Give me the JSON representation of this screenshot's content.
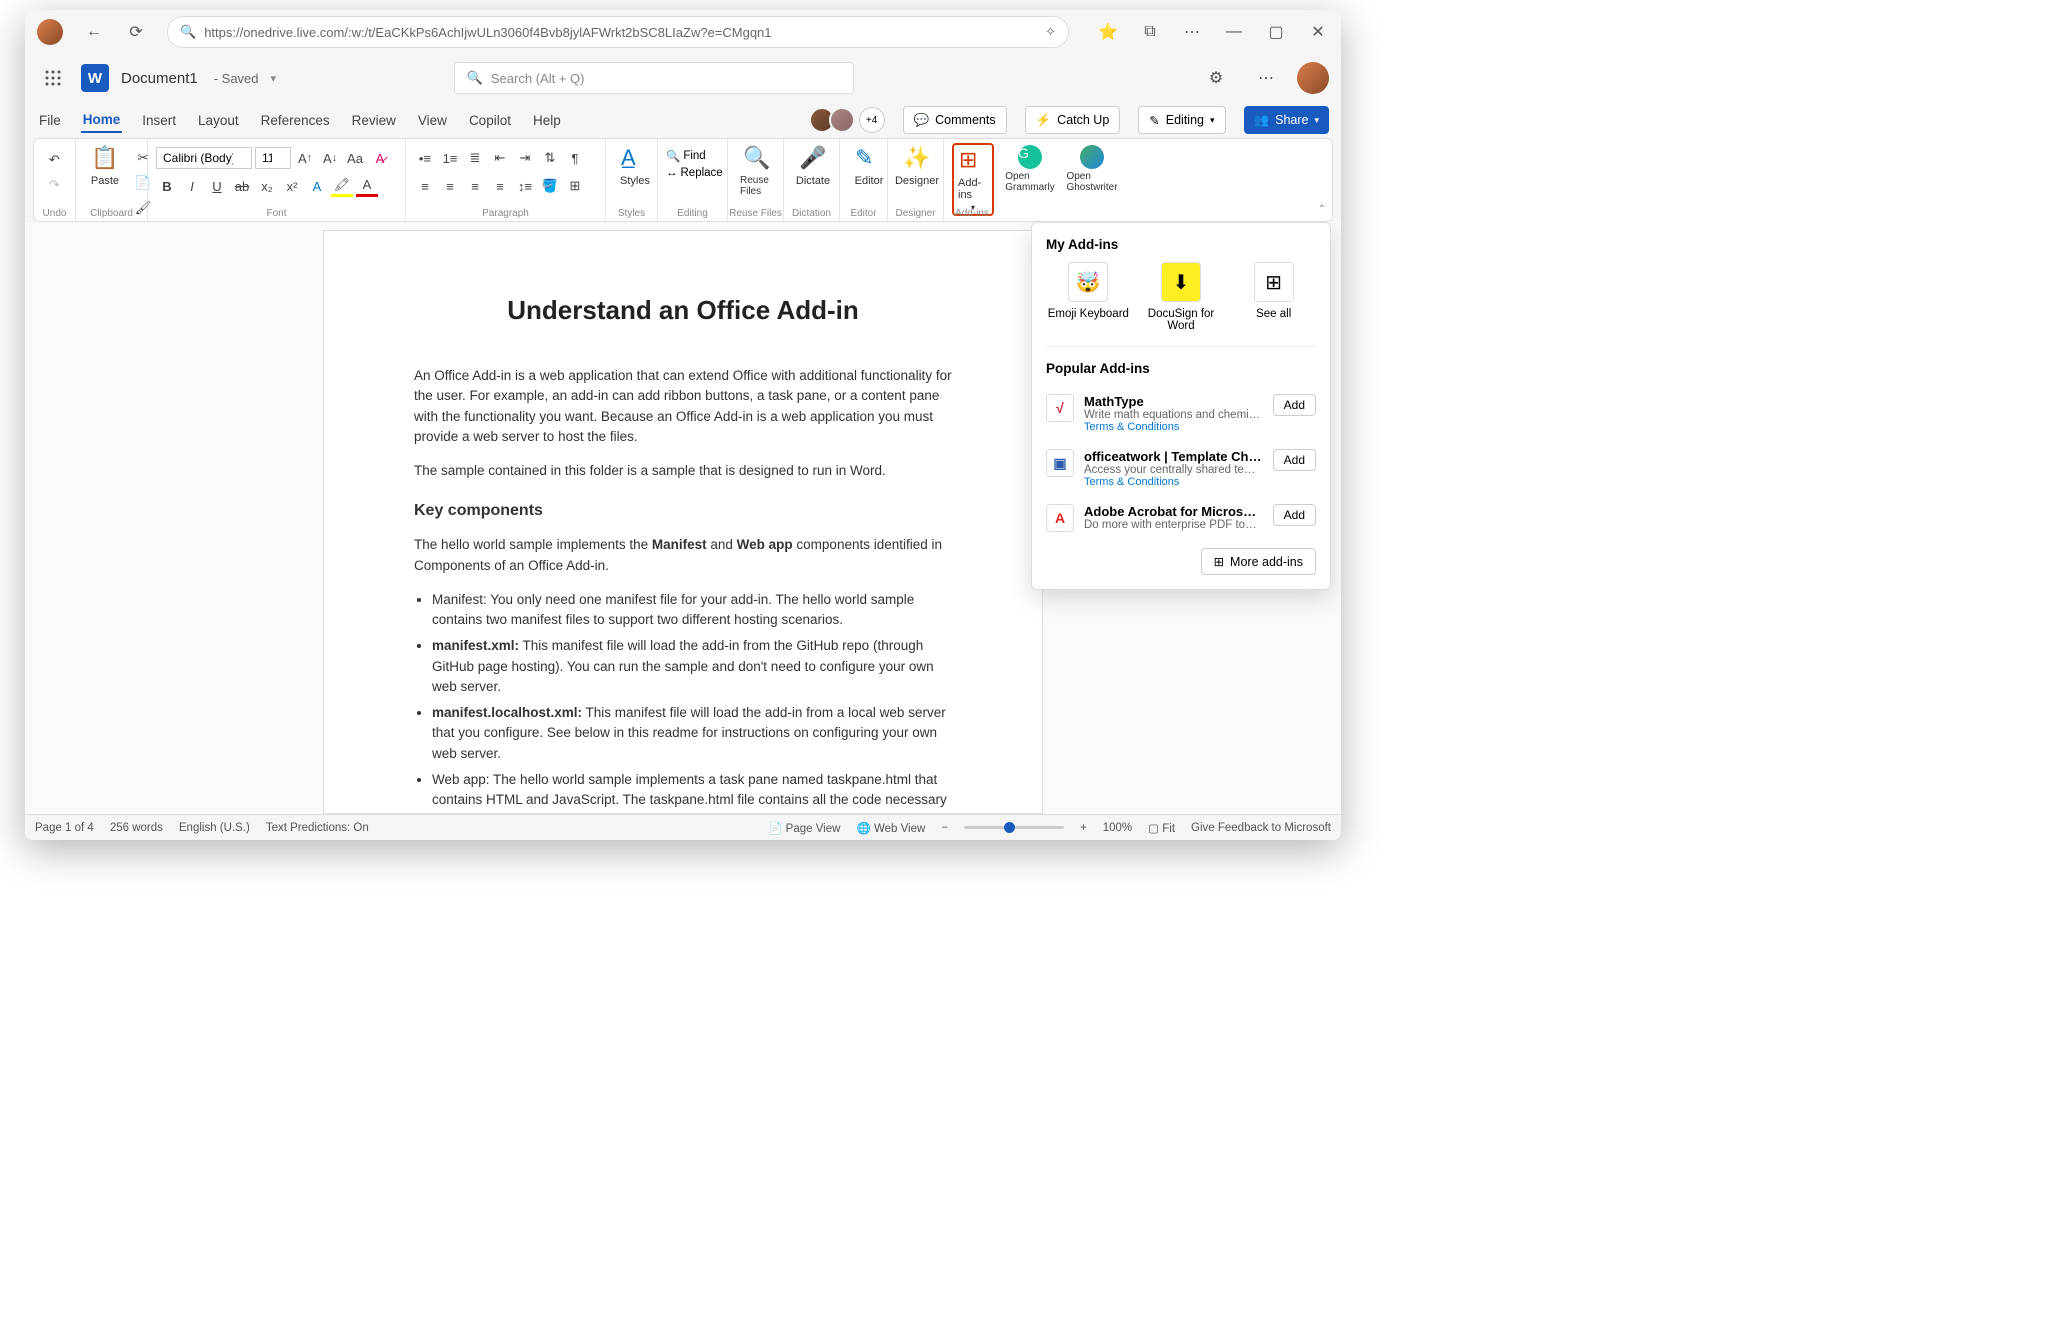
{
  "browser": {
    "url": "https://onedrive.live.com/:w:/t/EaCKkPs6AchIjwULn3060f4Bvb8jylAFWrkt2bSC8LIaZw?e=CMgqn1"
  },
  "header": {
    "doc_title": "Document1",
    "saved_label": "- Saved",
    "search_placeholder": "Search (Alt + Q)"
  },
  "tabs": [
    "File",
    "Home",
    "Insert",
    "Layout",
    "References",
    "Review",
    "View",
    "Copilot",
    "Help"
  ],
  "active_tab": "Home",
  "presence_more": "+4",
  "actions": {
    "comments": "Comments",
    "catchup": "Catch Up",
    "editing": "Editing",
    "share": "Share"
  },
  "ribbon": {
    "undo_label": "Undo",
    "clipboard_label": "Clipboard",
    "paste": "Paste",
    "font_label": "Font",
    "font_name": "Calibri (Body)",
    "font_size": "11",
    "para_label": "Paragraph",
    "styles_label": "Styles",
    "styles": "Styles",
    "editing_label": "Editing",
    "find": "Find",
    "replace": "Replace",
    "reuse_label": "Reuse Files",
    "reuse": "Reuse Files",
    "dictation_label": "Dictation",
    "dictate": "Dictate",
    "editor_label": "Editor",
    "editor": "Editor",
    "designer_label": "Designer",
    "designer": "Designer",
    "addins_label": "Add-ins",
    "addins": "Add-ins",
    "grammarly": "Open Grammarly",
    "ghostwriter": "Open Ghostwriter"
  },
  "doc": {
    "title": "Understand an Office Add-in",
    "p1": "An Office Add-in is a web application that can extend Office with additional functionality for the user. For example, an add-in can add ribbon buttons, a task pane, or a content pane with the functionality you want. Because an Office Add-in is a web application you must provide a web server to host the files.",
    "p2": "The sample contained in this folder is a sample that is designed to run in Word.",
    "h2": "Key components",
    "p3a": "The hello world sample implements the ",
    "p3b": "Manifest",
    "p3c": " and ",
    "p3d": "Web app",
    "p3e": " components identified in Components of an Office Add-in.",
    "li1": "Manifest: You only need one manifest file for your add-in. The hello world sample contains two manifest files to support two different hosting scenarios.",
    "li2a": "manifest.xml:",
    "li2b": " This manifest file will load the add-in from the GitHub repo (through GitHub page hosting). You can run the sample and don't need to configure your own web server.",
    "li3a": "manifest.localhost.xml:",
    "li3b": " This manifest file will load the add-in from a local web server that you configure. See below in this readme for instructions on configuring your own web server.",
    "li4": "Web app: The hello world sample implements a task pane named taskpane.html that contains HTML and JavaScript. The taskpane.html file contains all the code necessary to display a task pane, interact with the user, and write \"Hello World\" into the first Paragraph of the document."
  },
  "flyout": {
    "my_title": "My Add-ins",
    "tiles": [
      {
        "name": "Emoji Keyboard",
        "icon": "🤯"
      },
      {
        "name": "DocuSign for Word",
        "icon": "⬇"
      },
      {
        "name": "See all",
        "icon": "⊞"
      }
    ],
    "pop_title": "Popular Add-ins",
    "items": [
      {
        "title": "MathType",
        "desc": "Write math equations and chemical f…",
        "terms": "Terms & Conditions",
        "add": "Add",
        "ico": "√",
        "color": "#d02030"
      },
      {
        "title": "officeatwork | Template Choose…",
        "desc": "Access your centrally shared templats…",
        "terms": "Terms & Conditions",
        "add": "Add",
        "ico": "▣",
        "color": "#2a5caa"
      },
      {
        "title": "Adobe Acrobat for Microsoft W…",
        "desc": "Do more with enterprise PDF tools, b…",
        "terms": "",
        "add": "Add",
        "ico": "A",
        "color": "#e1251b"
      }
    ],
    "more": "More add-ins"
  },
  "status": {
    "page": "Page 1 of 4",
    "words": "256 words",
    "lang": "English (U.S.)",
    "pred": "Text Predictions: On",
    "pageview": "Page View",
    "webview": "Web View",
    "zoom": "100%",
    "fit": "Fit",
    "feedback": "Give Feedback to Microsoft"
  }
}
